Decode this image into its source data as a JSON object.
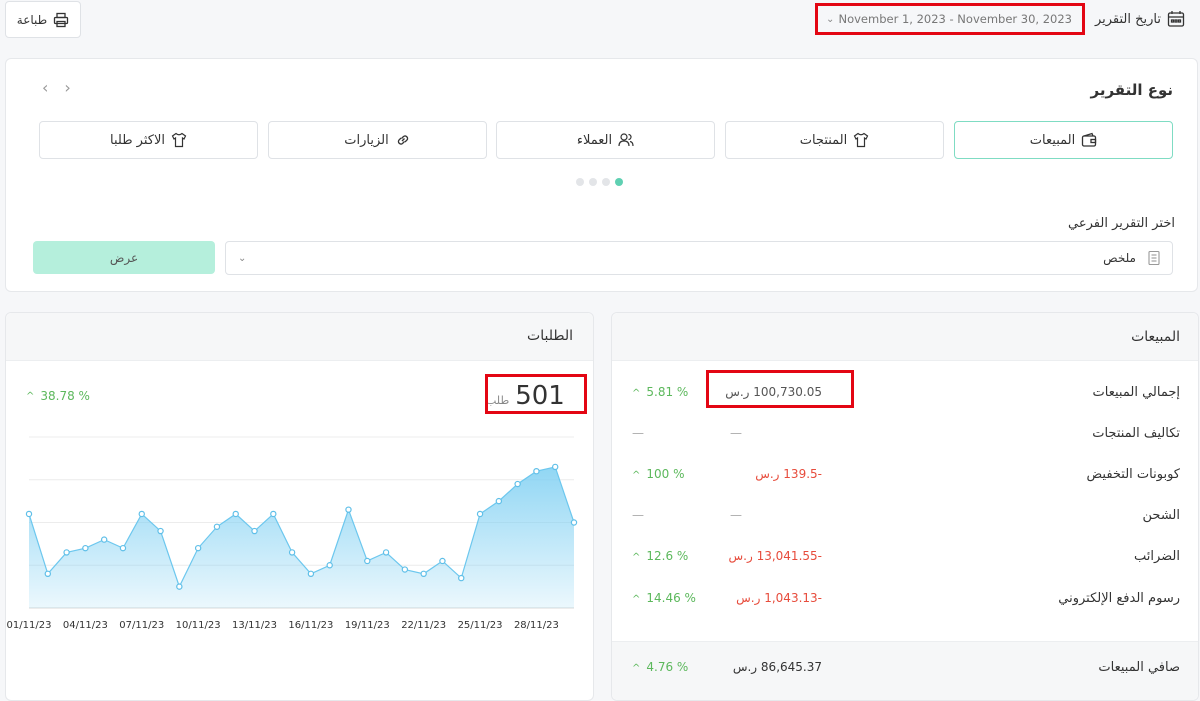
{
  "toolbar": {
    "print_label": "طباعة",
    "report_date_label": "تاريخ التقرير",
    "date_range": "November 1, 2023 - November 30, 2023"
  },
  "report_type": {
    "title": "نوع التقرير",
    "tabs": [
      {
        "label": "المبيعات",
        "icon": "wallet-icon",
        "active": true
      },
      {
        "label": "المنتجات",
        "icon": "tshirt-icon",
        "active": false
      },
      {
        "label": "العملاء",
        "icon": "users-icon",
        "active": false
      },
      {
        "label": "الزيارات",
        "icon": "link-icon",
        "active": false
      },
      {
        "label": "الاكثر طلبا",
        "icon": "tshirt-icon",
        "active": false
      }
    ],
    "sub_report_label": "اختر التقرير الفرعي",
    "sub_report_value": "ملخص",
    "view_button": "عرض"
  },
  "sales": {
    "title": "المبيعات",
    "rows": [
      {
        "label": "إجمالي المبيعات",
        "value": "100,730.05 ر.س",
        "pct": "5.81 %"
      },
      {
        "label": "تكاليف المنتجات",
        "value": "—",
        "pct": "—"
      },
      {
        "label": "كوبونات التخفيض",
        "value": "-139.5 ر.س",
        "pct": "100 %"
      },
      {
        "label": "الشحن",
        "value": "—",
        "pct": "—"
      },
      {
        "label": "الضرائب",
        "value": "-13,041.55 ر.س",
        "pct": "12.6 %"
      },
      {
        "label": "رسوم الدفع الإلكتروني",
        "value": "-1,043.13 ر.س",
        "pct": "14.46 %"
      }
    ],
    "net_label": "صافي المبيعات",
    "net_value": "86,645.37 ر.س",
    "net_pct": "4.76 %"
  },
  "orders": {
    "title": "الطلبات",
    "count": "501",
    "unit": "طلب",
    "pct": "38.78 %"
  },
  "colors": {
    "accent": "#7fdcc3",
    "line": "#7dcff2",
    "positive": "#5cb85c",
    "negative": "#e74c3c",
    "highlight": "#e30613"
  },
  "chart_data": {
    "type": "area",
    "x_tick_labels": [
      "01/11/23",
      "04/11/23",
      "07/11/23",
      "10/11/23",
      "13/11/23",
      "16/11/23",
      "19/11/23",
      "22/11/23",
      "25/11/23",
      "28/11/23"
    ],
    "x": [
      "01/11/23",
      "02/11/23",
      "03/11/23",
      "04/11/23",
      "05/11/23",
      "06/11/23",
      "07/11/23",
      "08/11/23",
      "09/11/23",
      "10/11/23",
      "11/11/23",
      "12/11/23",
      "13/11/23",
      "14/11/23",
      "15/11/23",
      "16/11/23",
      "17/11/23",
      "18/11/23",
      "19/11/23",
      "20/11/23",
      "21/11/23",
      "22/11/23",
      "23/11/23",
      "24/11/23",
      "25/11/23",
      "26/11/23",
      "27/11/23",
      "28/11/23",
      "29/11/23",
      "30/11/23"
    ],
    "values": [
      22,
      8,
      13,
      14,
      16,
      14,
      22,
      18,
      5,
      14,
      19,
      22,
      18,
      22,
      13,
      8,
      10,
      23,
      11,
      13,
      9,
      8,
      11,
      7,
      22,
      25,
      29,
      32,
      33,
      20
    ],
    "ylim": [
      0,
      40
    ],
    "grid": true
  }
}
